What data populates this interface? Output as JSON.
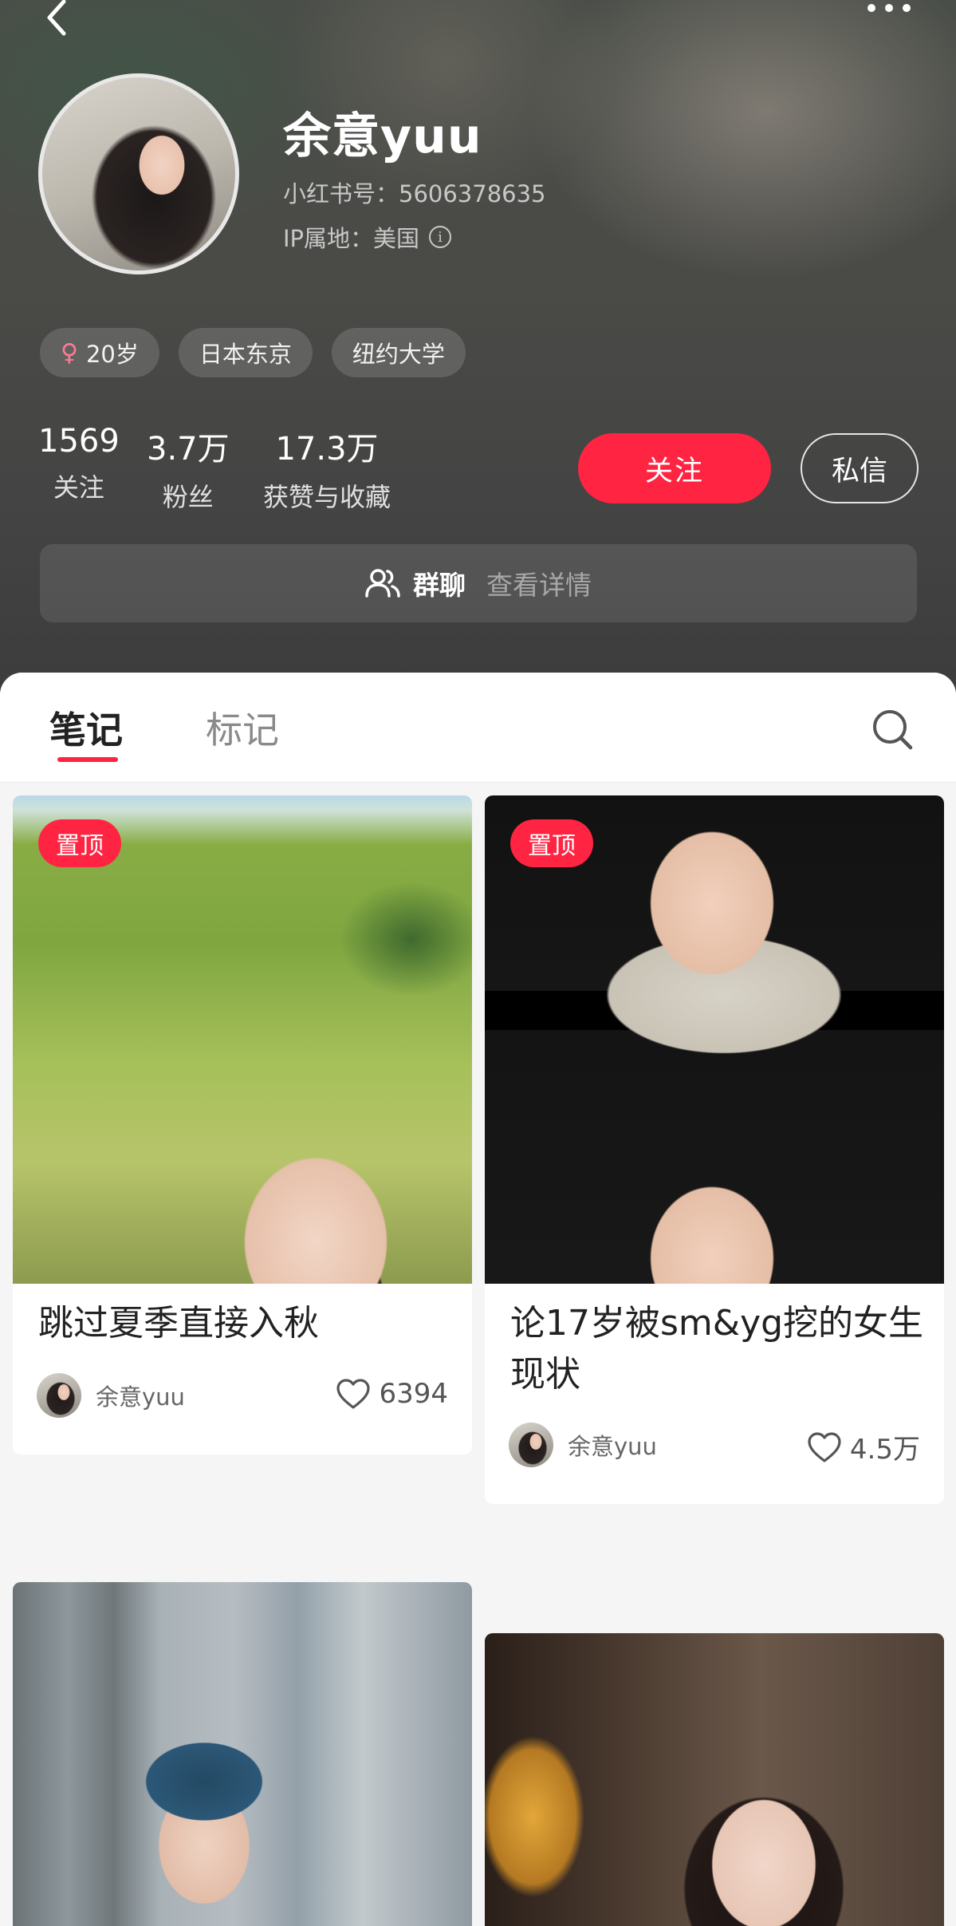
{
  "profile": {
    "username": "余意yuu",
    "red_id": "小红书号：5606378635",
    "ip_location": "IP属地：美国",
    "tags": {
      "age": "20岁",
      "city": "日本东京",
      "school": "纽约大学"
    },
    "stats": {
      "following": {
        "value": "1569",
        "label": "关注"
      },
      "fans": {
        "value": "3.7万",
        "label": "粉丝"
      },
      "likes": {
        "value": "17.3万",
        "label": "获赞与收藏"
      }
    },
    "follow_button": "关注",
    "message_button": "私信",
    "group": {
      "label": "群聊",
      "detail": "查看详情"
    }
  },
  "tabs": {
    "notes": "笔记",
    "tags": "标记"
  },
  "notes": [
    {
      "pin": "置顶",
      "title": "跳过夏季直接入秋",
      "author": "余意yuu",
      "likes": "6394"
    },
    {
      "pin": "置顶",
      "title": "论17岁被sm&yg挖的女生现状",
      "author": "余意yuu",
      "likes": "4.5万"
    }
  ],
  "icons": {
    "back": "back-arrow-icon",
    "more": "more-dots-icon",
    "info": "info-icon",
    "female": "female-icon",
    "group": "group-chat-icon",
    "search": "search-icon",
    "heart": "heart-icon"
  },
  "colors": {
    "accent": "#ff2442",
    "header_bg": "#454545",
    "panel_bg": "#f5f5f5"
  }
}
